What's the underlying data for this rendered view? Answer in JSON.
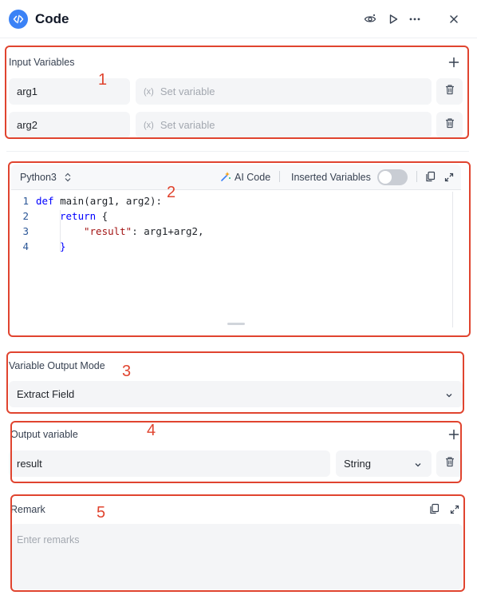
{
  "header": {
    "title": "Code",
    "icons": [
      "code-logo-icon",
      "preview-icon",
      "run-icon",
      "more-icon",
      "close-icon"
    ]
  },
  "markers": [
    "1",
    "2",
    "3",
    "4",
    "5"
  ],
  "input_variables": {
    "label": "Input Variables",
    "rows": [
      {
        "name": "arg1",
        "value_placeholder": "Set variable",
        "value_prefix": "(x)"
      },
      {
        "name": "arg2",
        "value_placeholder": "Set variable",
        "value_prefix": "(x)"
      }
    ]
  },
  "editor": {
    "language": "Python3",
    "ai_code_label": "AI Code",
    "inserted_variables_label": "Inserted Variables",
    "inserted_variables_on": false,
    "lines": [
      {
        "num": "1"
      },
      {
        "num": "2"
      },
      {
        "num": "3"
      },
      {
        "num": "4"
      }
    ],
    "code_tokens": {
      "l1_kw": "def",
      "l1_rest": " main(arg1, arg2):",
      "l2_kw": "return",
      "l2_rest": " {",
      "l3_str": "\"result\"",
      "l3_rest": ": arg1+arg2,",
      "l4": "}"
    }
  },
  "output_mode": {
    "label": "Variable Output Mode",
    "value": "Extract Field"
  },
  "output_variable": {
    "label": "Output variable",
    "name": "result",
    "type": "String"
  },
  "remark": {
    "label": "Remark",
    "placeholder": "Enter remarks"
  },
  "colors": {
    "accent": "#3b82f6",
    "annotation": "#e0442f",
    "field_bg": "#f4f5f7"
  }
}
